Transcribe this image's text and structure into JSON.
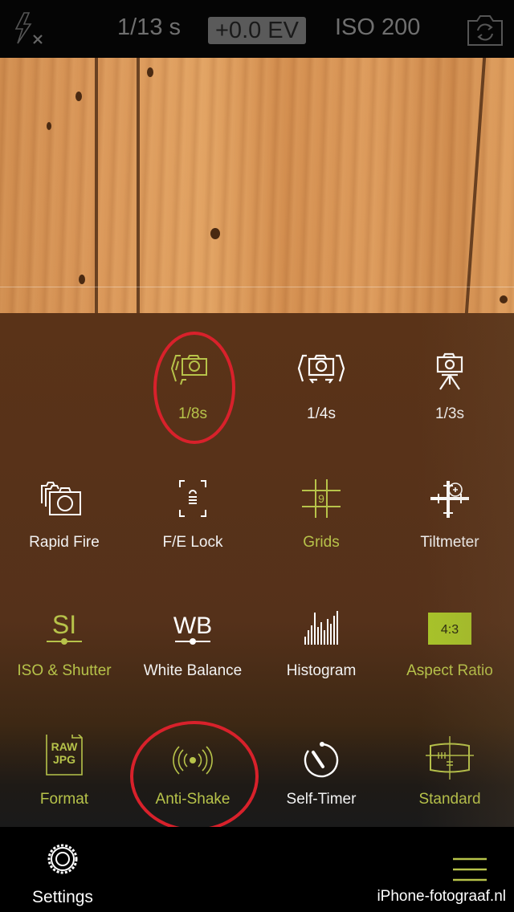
{
  "topbar": {
    "flash_icon": "flash-off-icon",
    "shutter": "1/13 s",
    "ev": "+0.0 EV",
    "iso": "ISO 200",
    "camera_flip_icon": "camera-switch-icon"
  },
  "anti_shake_options": [
    {
      "label": "1/8s",
      "icon": "handheld-camera-icon",
      "active": true
    },
    {
      "label": "1/4s",
      "icon": "stabilized-camera-icon",
      "active": false
    },
    {
      "label": "1/3s",
      "icon": "tripod-camera-icon",
      "active": false
    }
  ],
  "grid": [
    {
      "label": "Rapid Fire",
      "icon": "rapid-fire-icon",
      "active": false
    },
    {
      "label": "F/E Lock",
      "icon": "fe-lock-icon",
      "active": false
    },
    {
      "label": "Grids",
      "icon": "grid-icon",
      "active": true,
      "badge": "9"
    },
    {
      "label": "Tiltmeter",
      "icon": "tiltmeter-icon",
      "active": false
    },
    {
      "label": "ISO & Shutter",
      "icon": "iso-shutter-icon",
      "active": true,
      "glyph": "SI"
    },
    {
      "label": "White Balance",
      "icon": "white-balance-icon",
      "active": false,
      "glyph": "WB"
    },
    {
      "label": "Histogram",
      "icon": "histogram-icon",
      "active": false
    },
    {
      "label": "Aspect Ratio",
      "icon": "aspect-ratio-icon",
      "active": true,
      "badge": "4:3"
    },
    {
      "label": "Format",
      "icon": "raw-jpg-icon",
      "active": true,
      "glyph_top": "RAW",
      "glyph_bottom": "JPG"
    },
    {
      "label": "Anti-Shake",
      "icon": "anti-shake-icon",
      "active": true
    },
    {
      "label": "Self-Timer",
      "icon": "self-timer-icon",
      "active": false
    },
    {
      "label": "Standard",
      "icon": "standard-mode-icon",
      "active": true
    }
  ],
  "bottombar": {
    "settings_label": "Settings",
    "menu_icon": "hamburger-menu-icon",
    "credit": "iPhone-fotograaf.nl"
  },
  "colors": {
    "accent": "#b7c34a",
    "annotation": "#d8212b",
    "panel": "#55311a"
  }
}
